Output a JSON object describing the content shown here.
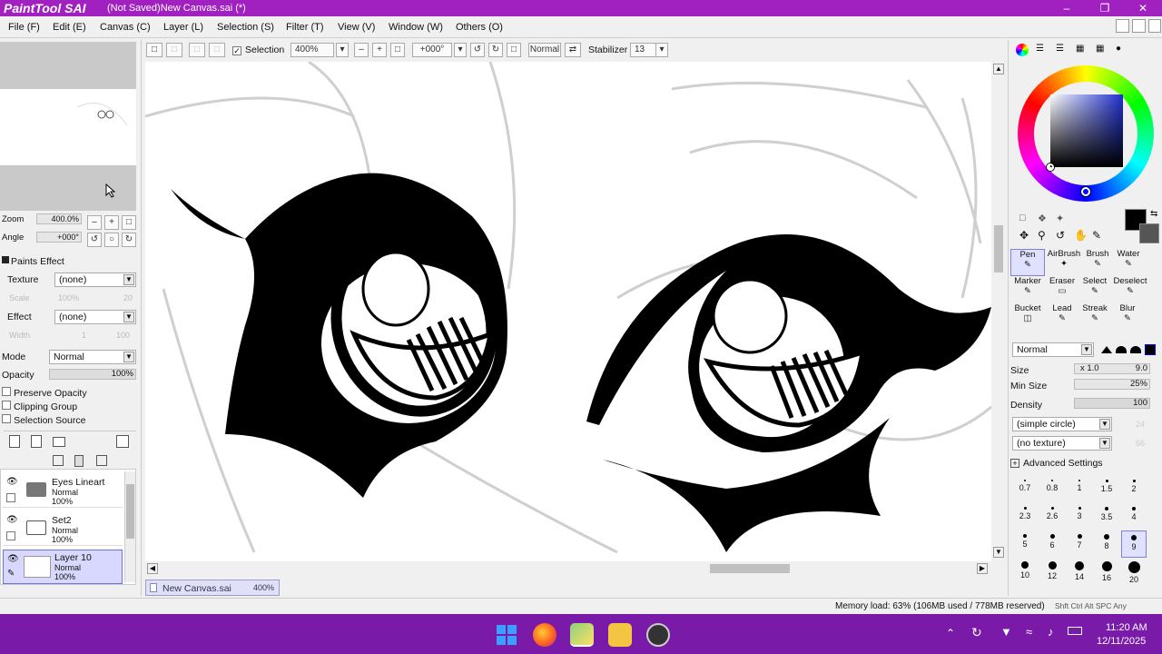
{
  "app": {
    "logo": "PaintTool SAI",
    "window_title": "(Not Saved)New Canvas.sai (*)"
  },
  "menu": [
    "File (F)",
    "Edit (E)",
    "Canvas (C)",
    "Layer (L)",
    "Selection (S)",
    "Filter (T)",
    "View (V)",
    "Window (W)",
    "Others (O)"
  ],
  "toolbar": {
    "selection_label": "Selection",
    "zoom_value": "400%",
    "angle_value": "+000°",
    "blend_mode": "Normal",
    "stabilizer_label": "Stabilizer",
    "stabilizer_value": "13"
  },
  "navigator": {
    "zoom_label": "Zoom",
    "zoom_value": "400.0%",
    "angle_label": "Angle",
    "angle_value": "+000°"
  },
  "paints_effect": {
    "header": "Paints Effect",
    "texture_label": "Texture",
    "texture_value": "(none)",
    "scale_label": "Scale",
    "scale_value": "100%",
    "scale_num": "20",
    "effect_label": "Effect",
    "effect_value": "(none)",
    "width_label": "Width",
    "width_num": "1",
    "width_value": "100"
  },
  "layer_props": {
    "mode_label": "Mode",
    "mode_value": "Normal",
    "opacity_label": "Opacity",
    "opacity_value": "100%",
    "preserve_opacity": "Preserve Opacity",
    "clipping_group": "Clipping Group",
    "selection_source": "Selection Source"
  },
  "layers": [
    {
      "name": "Eyes Lineart",
      "mode": "Normal",
      "opacity": "100%"
    },
    {
      "name": "Set2",
      "mode": "Normal",
      "opacity": "100%"
    },
    {
      "name": "Layer 10",
      "mode": "Normal",
      "opacity": "100%"
    }
  ],
  "document_tab": {
    "name": "New Canvas.sai",
    "zoom": "400%"
  },
  "tools": [
    {
      "label": "Pen",
      "selected": true
    },
    {
      "label": "AirBrush",
      "selected": false
    },
    {
      "label": "Brush",
      "selected": false
    },
    {
      "label": "Water",
      "selected": false
    },
    {
      "label": "Marker",
      "selected": false
    },
    {
      "label": "Eraser",
      "selected": false
    },
    {
      "label": "Select",
      "selected": false
    },
    {
      "label": "Deselect",
      "selected": false
    },
    {
      "label": "Bucket",
      "selected": false
    },
    {
      "label": "Lead",
      "selected": false
    },
    {
      "label": "Streak",
      "selected": false
    },
    {
      "label": "Blur",
      "selected": false
    }
  ],
  "brush": {
    "mode_value": "Normal",
    "size_label": "Size",
    "size_mult": "x 1.0",
    "size_value": "9.0",
    "min_size_label": "Min Size",
    "min_size_value": "25%",
    "density_label": "Density",
    "density_value": "100",
    "shape_value": "(simple circle)",
    "shape_num": "24",
    "texture_value": "(no texture)",
    "texture_num": "66",
    "advanced_label": "Advanced Settings"
  },
  "brush_sizes": [
    "0.7",
    "0.8",
    "1",
    "1.5",
    "2",
    "2.3",
    "2.6",
    "3",
    "3.5",
    "4",
    "5",
    "6",
    "7",
    "8",
    "9",
    "10",
    "12",
    "14",
    "16",
    "20"
  ],
  "status": {
    "memory": "Memory load: 63% (106MB used / 778MB reserved)",
    "keys": "Shft Ctrl Alt SPC Any"
  },
  "taskbar": {
    "time": "11:20 AM",
    "date": "12/11/2025"
  },
  "colors": {
    "accent": "#a020c0",
    "taskbar": "#7a1aa8"
  }
}
